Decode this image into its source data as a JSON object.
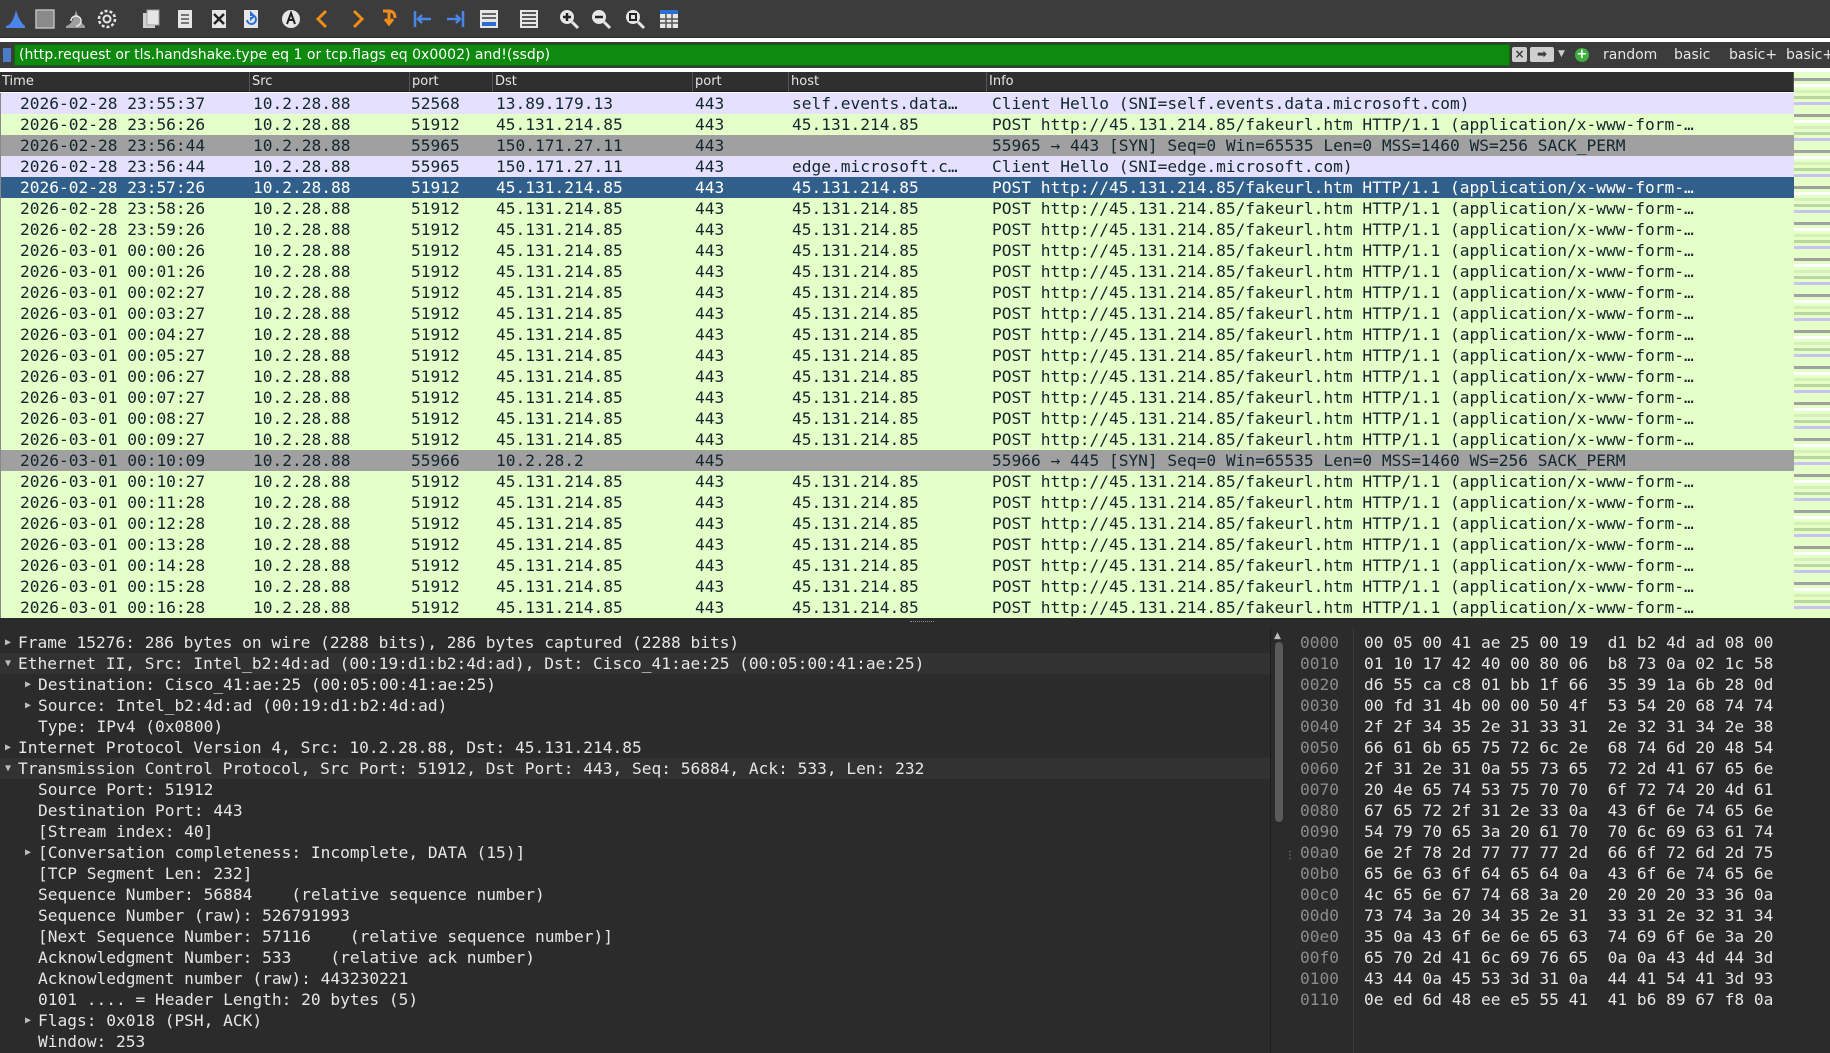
{
  "toolbar": {
    "buttons": [
      {
        "name": "shark-fin-icon",
        "color": "#4a86e8"
      },
      {
        "name": "stop-capture-icon",
        "color": "#9e9e9e"
      },
      {
        "name": "restart-capture-icon",
        "color": "#9e9e9e"
      },
      {
        "name": "capture-options-icon",
        "color": "#e6e6e6"
      },
      {
        "name": "open-file-icon",
        "color": "#cfcfcf"
      },
      {
        "name": "save-file-icon",
        "color": "#cfcfcf"
      },
      {
        "name": "close-file-icon",
        "color": "#cfcfcf"
      },
      {
        "name": "reload-file-icon",
        "color": "#cfcfcf"
      },
      {
        "name": "find-packet-icon",
        "color": "#e6e6e6"
      },
      {
        "name": "go-back-icon",
        "color": "#f08c1a"
      },
      {
        "name": "go-forward-icon",
        "color": "#f08c1a"
      },
      {
        "name": "go-to-packet-icon",
        "color": "#f08c1a"
      },
      {
        "name": "first-packet-icon",
        "color": "#4a86e8"
      },
      {
        "name": "last-packet-icon",
        "color": "#4a86e8"
      },
      {
        "name": "autoscroll-icon",
        "color": "#cfcfcf"
      },
      {
        "name": "colorize-icon",
        "color": "#cfcfcf"
      },
      {
        "name": "zoom-in-icon",
        "color": "#e6e6e6"
      },
      {
        "name": "zoom-out-icon",
        "color": "#e6e6e6"
      },
      {
        "name": "zoom-normal-icon",
        "color": "#e6e6e6"
      },
      {
        "name": "resize-columns-icon",
        "color": "#cfcfcf"
      }
    ]
  },
  "filter": {
    "text": "(http.request or tls.handshake.type eq 1 or tcp.flags eq 0x0002) and!(ssdp)",
    "buttons": [
      "random",
      "basic",
      "basic+",
      "basic+-"
    ]
  },
  "packet_list": {
    "columns": [
      "Time",
      "Src",
      "port",
      "Dst",
      "port",
      "host",
      "Info"
    ],
    "rows": [
      {
        "type": "tls",
        "time": "2026-02-28 23:55:37",
        "src": "10.2.28.88",
        "sport": "52568",
        "dst": "13.89.179.13",
        "dport": "443",
        "host": "self.events.data…",
        "info": "Client Hello (SNI=self.events.data.microsoft.com)"
      },
      {
        "type": "http",
        "time": "2026-02-28 23:56:26",
        "src": "10.2.28.88",
        "sport": "51912",
        "dst": "45.131.214.85",
        "dport": "443",
        "host": "45.131.214.85",
        "info": "POST http://45.131.214.85/fakeurl.htm HTTP/1.1  (application/x-www-form-…"
      },
      {
        "type": "syn",
        "time": "2026-02-28 23:56:44",
        "src": "10.2.28.88",
        "sport": "55965",
        "dst": "150.171.27.11",
        "dport": "443",
        "host": "",
        "info": "55965 → 443 [SYN] Seq=0 Win=65535 Len=0 MSS=1460 WS=256 SACK_PERM"
      },
      {
        "type": "tls",
        "time": "2026-02-28 23:56:44",
        "src": "10.2.28.88",
        "sport": "55965",
        "dst": "150.171.27.11",
        "dport": "443",
        "host": "edge.microsoft.c…",
        "info": "Client Hello (SNI=edge.microsoft.com)"
      },
      {
        "type": "sel",
        "time": "2026-02-28 23:57:26",
        "src": "10.2.28.88",
        "sport": "51912",
        "dst": "45.131.214.85",
        "dport": "443",
        "host": "45.131.214.85",
        "info": "POST http://45.131.214.85/fakeurl.htm HTTP/1.1  (application/x-www-form-…"
      },
      {
        "type": "http",
        "time": "2026-02-28 23:58:26",
        "src": "10.2.28.88",
        "sport": "51912",
        "dst": "45.131.214.85",
        "dport": "443",
        "host": "45.131.214.85",
        "info": "POST http://45.131.214.85/fakeurl.htm HTTP/1.1  (application/x-www-form-…"
      },
      {
        "type": "http",
        "time": "2026-02-28 23:59:26",
        "src": "10.2.28.88",
        "sport": "51912",
        "dst": "45.131.214.85",
        "dport": "443",
        "host": "45.131.214.85",
        "info": "POST http://45.131.214.85/fakeurl.htm HTTP/1.1  (application/x-www-form-…"
      },
      {
        "type": "http",
        "time": "2026-03-01 00:00:26",
        "src": "10.2.28.88",
        "sport": "51912",
        "dst": "45.131.214.85",
        "dport": "443",
        "host": "45.131.214.85",
        "info": "POST http://45.131.214.85/fakeurl.htm HTTP/1.1  (application/x-www-form-…"
      },
      {
        "type": "http",
        "time": "2026-03-01 00:01:26",
        "src": "10.2.28.88",
        "sport": "51912",
        "dst": "45.131.214.85",
        "dport": "443",
        "host": "45.131.214.85",
        "info": "POST http://45.131.214.85/fakeurl.htm HTTP/1.1  (application/x-www-form-…"
      },
      {
        "type": "http",
        "time": "2026-03-01 00:02:27",
        "src": "10.2.28.88",
        "sport": "51912",
        "dst": "45.131.214.85",
        "dport": "443",
        "host": "45.131.214.85",
        "info": "POST http://45.131.214.85/fakeurl.htm HTTP/1.1  (application/x-www-form-…"
      },
      {
        "type": "http",
        "time": "2026-03-01 00:03:27",
        "src": "10.2.28.88",
        "sport": "51912",
        "dst": "45.131.214.85",
        "dport": "443",
        "host": "45.131.214.85",
        "info": "POST http://45.131.214.85/fakeurl.htm HTTP/1.1  (application/x-www-form-…"
      },
      {
        "type": "http",
        "time": "2026-03-01 00:04:27",
        "src": "10.2.28.88",
        "sport": "51912",
        "dst": "45.131.214.85",
        "dport": "443",
        "host": "45.131.214.85",
        "info": "POST http://45.131.214.85/fakeurl.htm HTTP/1.1  (application/x-www-form-…"
      },
      {
        "type": "http",
        "time": "2026-03-01 00:05:27",
        "src": "10.2.28.88",
        "sport": "51912",
        "dst": "45.131.214.85",
        "dport": "443",
        "host": "45.131.214.85",
        "info": "POST http://45.131.214.85/fakeurl.htm HTTP/1.1  (application/x-www-form-…"
      },
      {
        "type": "http",
        "time": "2026-03-01 00:06:27",
        "src": "10.2.28.88",
        "sport": "51912",
        "dst": "45.131.214.85",
        "dport": "443",
        "host": "45.131.214.85",
        "info": "POST http://45.131.214.85/fakeurl.htm HTTP/1.1  (application/x-www-form-…"
      },
      {
        "type": "http",
        "time": "2026-03-01 00:07:27",
        "src": "10.2.28.88",
        "sport": "51912",
        "dst": "45.131.214.85",
        "dport": "443",
        "host": "45.131.214.85",
        "info": "POST http://45.131.214.85/fakeurl.htm HTTP/1.1  (application/x-www-form-…"
      },
      {
        "type": "http",
        "time": "2026-03-01 00:08:27",
        "src": "10.2.28.88",
        "sport": "51912",
        "dst": "45.131.214.85",
        "dport": "443",
        "host": "45.131.214.85",
        "info": "POST http://45.131.214.85/fakeurl.htm HTTP/1.1  (application/x-www-form-…"
      },
      {
        "type": "http",
        "time": "2026-03-01 00:09:27",
        "src": "10.2.28.88",
        "sport": "51912",
        "dst": "45.131.214.85",
        "dport": "443",
        "host": "45.131.214.85",
        "info": "POST http://45.131.214.85/fakeurl.htm HTTP/1.1  (application/x-www-form-…"
      },
      {
        "type": "syn",
        "time": "2026-03-01 00:10:09",
        "src": "10.2.28.88",
        "sport": "55966",
        "dst": "10.2.28.2",
        "dport": "445",
        "host": "",
        "info": "55966 → 445 [SYN] Seq=0 Win=65535 Len=0 MSS=1460 WS=256 SACK_PERM"
      },
      {
        "type": "http",
        "time": "2026-03-01 00:10:27",
        "src": "10.2.28.88",
        "sport": "51912",
        "dst": "45.131.214.85",
        "dport": "443",
        "host": "45.131.214.85",
        "info": "POST http://45.131.214.85/fakeurl.htm HTTP/1.1  (application/x-www-form-…"
      },
      {
        "type": "http",
        "time": "2026-03-01 00:11:28",
        "src": "10.2.28.88",
        "sport": "51912",
        "dst": "45.131.214.85",
        "dport": "443",
        "host": "45.131.214.85",
        "info": "POST http://45.131.214.85/fakeurl.htm HTTP/1.1  (application/x-www-form-…"
      },
      {
        "type": "http",
        "time": "2026-03-01 00:12:28",
        "src": "10.2.28.88",
        "sport": "51912",
        "dst": "45.131.214.85",
        "dport": "443",
        "host": "45.131.214.85",
        "info": "POST http://45.131.214.85/fakeurl.htm HTTP/1.1  (application/x-www-form-…"
      },
      {
        "type": "http",
        "time": "2026-03-01 00:13:28",
        "src": "10.2.28.88",
        "sport": "51912",
        "dst": "45.131.214.85",
        "dport": "443",
        "host": "45.131.214.85",
        "info": "POST http://45.131.214.85/fakeurl.htm HTTP/1.1  (application/x-www-form-…"
      },
      {
        "type": "http",
        "time": "2026-03-01 00:14:28",
        "src": "10.2.28.88",
        "sport": "51912",
        "dst": "45.131.214.85",
        "dport": "443",
        "host": "45.131.214.85",
        "info": "POST http://45.131.214.85/fakeurl.htm HTTP/1.1  (application/x-www-form-…"
      },
      {
        "type": "http",
        "time": "2026-03-01 00:15:28",
        "src": "10.2.28.88",
        "sport": "51912",
        "dst": "45.131.214.85",
        "dport": "443",
        "host": "45.131.214.85",
        "info": "POST http://45.131.214.85/fakeurl.htm HTTP/1.1  (application/x-www-form-…"
      },
      {
        "type": "http",
        "time": "2026-03-01 00:16:28",
        "src": "10.2.28.88",
        "sport": "51912",
        "dst": "45.131.214.85",
        "dport": "443",
        "host": "45.131.214.85",
        "info": "POST http://45.131.214.85/fakeurl.htm HTTP/1.1  (application/x-www-form-…"
      }
    ],
    "row_colors": {
      "tls": "#e4e0fd",
      "http": "#e4ffc7",
      "syn": "#a0a0a0",
      "sel": "#2f5f8a"
    }
  },
  "details": {
    "lines": [
      {
        "level": 0,
        "arrow": "collapsed",
        "text": "Frame 15276: 286 bytes on wire (2288 bits), 286 bytes captured (2288 bits)"
      },
      {
        "level": 0,
        "arrow": "expanded",
        "text": "Ethernet II, Src: Intel_b2:4d:ad (00:19:d1:b2:4d:ad), Dst: Cisco_41:ae:25 (00:05:00:41:ae:25)"
      },
      {
        "level": 1,
        "arrow": "collapsed",
        "text": "Destination: Cisco_41:ae:25 (00:05:00:41:ae:25)"
      },
      {
        "level": 1,
        "arrow": "collapsed",
        "text": "Source: Intel_b2:4d:ad (00:19:d1:b2:4d:ad)"
      },
      {
        "level": 1,
        "arrow": "none",
        "text": "Type: IPv4 (0x0800)"
      },
      {
        "level": 0,
        "arrow": "collapsed",
        "text": "Internet Protocol Version 4, Src: 10.2.28.88, Dst: 45.131.214.85"
      },
      {
        "level": 0,
        "arrow": "expanded",
        "text": "Transmission Control Protocol, Src Port: 51912, Dst Port: 443, Seq: 56884, Ack: 533, Len: 232"
      },
      {
        "level": 1,
        "arrow": "none",
        "text": "Source Port: 51912"
      },
      {
        "level": 1,
        "arrow": "none",
        "text": "Destination Port: 443"
      },
      {
        "level": 1,
        "arrow": "none",
        "text": "[Stream index: 40]"
      },
      {
        "level": 1,
        "arrow": "collapsed",
        "text": "[Conversation completeness: Incomplete, DATA (15)]"
      },
      {
        "level": 1,
        "arrow": "none",
        "text": "[TCP Segment Len: 232]"
      },
      {
        "level": 1,
        "arrow": "none",
        "text": "Sequence Number: 56884    (relative sequence number)"
      },
      {
        "level": 1,
        "arrow": "none",
        "text": "Sequence Number (raw): 526791993"
      },
      {
        "level": 1,
        "arrow": "none",
        "text": "[Next Sequence Number: 57116    (relative sequence number)]"
      },
      {
        "level": 1,
        "arrow": "none",
        "text": "Acknowledgment Number: 533    (relative ack number)"
      },
      {
        "level": 1,
        "arrow": "none",
        "text": "Acknowledgment number (raw): 443230221"
      },
      {
        "level": 1,
        "arrow": "none",
        "text": "0101 .... = Header Length: 20 bytes (5)"
      },
      {
        "level": 1,
        "arrow": "collapsed",
        "text": "Flags: 0x018 (PSH, ACK)"
      },
      {
        "level": 1,
        "arrow": "none",
        "text": "Window: 253"
      }
    ]
  },
  "bytes": {
    "offsets": [
      "0000",
      "0010",
      "0020",
      "0030",
      "0040",
      "0050",
      "0060",
      "0070",
      "0080",
      "0090",
      "00a0",
      "00b0",
      "00c0",
      "00d0",
      "00e0",
      "00f0",
      "0100",
      "0110"
    ],
    "hex": [
      "00 05 00 41 ae 25 00 19  d1 b2 4d ad 08 00",
      "01 10 17 42 40 00 80 06  b8 73 0a 02 1c 58",
      "d6 55 ca c8 01 bb 1f 66  35 39 1a 6b 28 0d",
      "00 fd 31 4b 00 00 50 4f  53 54 20 68 74 74",
      "2f 2f 34 35 2e 31 33 31  2e 32 31 34 2e 38",
      "66 61 6b 65 75 72 6c 2e  68 74 6d 20 48 54",
      "2f 31 2e 31 0a 55 73 65  72 2d 41 67 65 6e",
      "20 4e 65 74 53 75 70 70  6f 72 74 20 4d 61",
      "67 65 72 2f 31 2e 33 0a  43 6f 6e 74 65 6e",
      "54 79 70 65 3a 20 61 70  70 6c 69 63 61 74",
      "6e 2f 78 2d 77 77 77 2d  66 6f 72 6d 2d 75",
      "65 6e 63 6f 64 65 64 0a  43 6f 6e 74 65 6e",
      "4c 65 6e 67 74 68 3a 20  20 20 20 33 36 0a",
      "73 74 3a 20 34 35 2e 31  33 31 2e 32 31 34",
      "35 0a 43 6f 6e 6e 65 63  74 69 6f 6e 3a 20",
      "65 70 2d 41 6c 69 76 65  0a 0a 43 4d 44 3d",
      "43 44 0a 45 53 3d 31 0a  44 41 54 41 3d 93",
      "0e ed 6d 48 ee e5 55 41  41 b6 89 67 f8 0a"
    ]
  }
}
